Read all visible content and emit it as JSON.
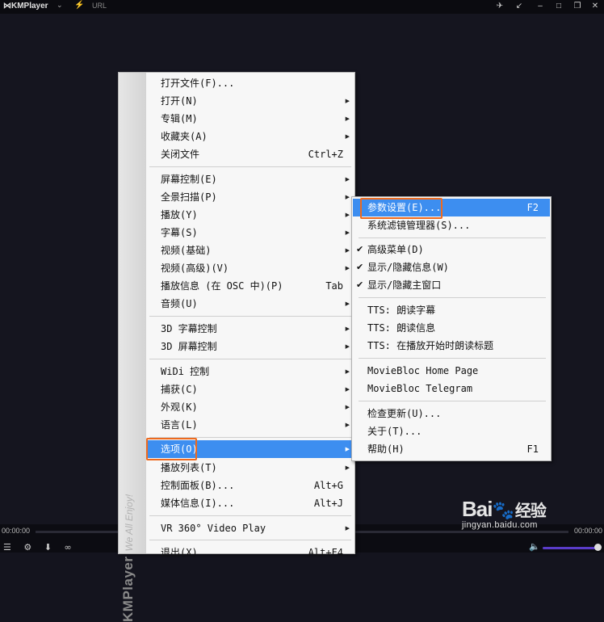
{
  "titlebar": {
    "app_name": "KMPlayer",
    "url_label": "URL",
    "logo_icon": "kmplayer-logo-icon",
    "controls": [
      "pin-icon",
      "minimize-to-corner-icon",
      "minimize-icon",
      "maximize-icon",
      "close-icon"
    ]
  },
  "bottom": {
    "time_left": "00:00:00",
    "time_right": "00:00:00"
  },
  "strip": {
    "brand": "KMPlayer",
    "tagline": "We All Enjoy!"
  },
  "main_menu": {
    "items": [
      {
        "label": "打开文件(F)...",
        "shortcut": "",
        "arrow": ""
      },
      {
        "label": "打开(N)",
        "shortcut": "",
        "arrow": "▶"
      },
      {
        "label": "专辑(M)",
        "shortcut": "",
        "arrow": "▶"
      },
      {
        "label": "收藏夹(A)",
        "shortcut": "",
        "arrow": "▶"
      },
      {
        "label": "关闭文件",
        "shortcut": "Ctrl+Z",
        "arrow": ""
      },
      {
        "label": "屏幕控制(E)",
        "shortcut": "",
        "arrow": "▶"
      },
      {
        "label": "全景扫描(P)",
        "shortcut": "",
        "arrow": "▶"
      },
      {
        "label": "播放(Y)",
        "shortcut": "",
        "arrow": "▶"
      },
      {
        "label": "字幕(S)",
        "shortcut": "",
        "arrow": "▶"
      },
      {
        "label": "视频(基础)",
        "shortcut": "",
        "arrow": "▶"
      },
      {
        "label": "视频(高级)(V)",
        "shortcut": "",
        "arrow": "▶"
      },
      {
        "label": "播放信息 (在 OSC 中)(P)",
        "shortcut": "Tab",
        "arrow": ""
      },
      {
        "label": "音频(U)",
        "shortcut": "",
        "arrow": "▶"
      },
      {
        "label": "3D 字幕控制",
        "shortcut": "",
        "arrow": "▶"
      },
      {
        "label": "3D 屏幕控制",
        "shortcut": "",
        "arrow": "▶"
      },
      {
        "label": "WiDi 控制",
        "shortcut": "",
        "arrow": "▶"
      },
      {
        "label": "捕获(C)",
        "shortcut": "",
        "arrow": "▶"
      },
      {
        "label": "外观(K)",
        "shortcut": "",
        "arrow": "▶"
      },
      {
        "label": "语言(L)",
        "shortcut": "",
        "arrow": "▶"
      },
      {
        "label": "选项(O)",
        "shortcut": "",
        "arrow": "▶"
      },
      {
        "label": "播放列表(T)",
        "shortcut": "",
        "arrow": "▶"
      },
      {
        "label": "控制面板(B)...",
        "shortcut": "Alt+G",
        "arrow": ""
      },
      {
        "label": "媒体信息(I)...",
        "shortcut": "Alt+J",
        "arrow": ""
      },
      {
        "label": "VR 360° Video Play",
        "shortcut": "",
        "arrow": "▶"
      },
      {
        "label": "退出(X)",
        "shortcut": "Alt+F4",
        "arrow": ""
      }
    ]
  },
  "sub_menu": {
    "items": [
      {
        "label": "参数设置(E)...",
        "shortcut": "F2",
        "check": ""
      },
      {
        "label": "系统滤镜管理器(S)...",
        "shortcut": "",
        "check": ""
      },
      {
        "label": "高级菜单(D)",
        "shortcut": "",
        "check": "✔"
      },
      {
        "label": "显示/隐藏信息(W)",
        "shortcut": "",
        "check": "✔"
      },
      {
        "label": "显示/隐藏主窗口",
        "shortcut": "",
        "check": "✔"
      },
      {
        "label": "TTS: 朗读字幕",
        "shortcut": "",
        "check": ""
      },
      {
        "label": "TTS: 朗读信息",
        "shortcut": "",
        "check": ""
      },
      {
        "label": "TTS: 在播放开始时朗读标题",
        "shortcut": "",
        "check": ""
      },
      {
        "label": "MovieBloc Home Page",
        "shortcut": "",
        "check": ""
      },
      {
        "label": "MovieBloc Telegram",
        "shortcut": "",
        "check": ""
      },
      {
        "label": "检查更新(U)...",
        "shortcut": "",
        "check": ""
      },
      {
        "label": "关于(T)...",
        "shortcut": "",
        "check": ""
      },
      {
        "label": "帮助(H)",
        "shortcut": "F1",
        "check": ""
      }
    ]
  },
  "watermark": {
    "logo": "Bai",
    "logo_cn": "经验",
    "url": "jingyan.baidu.com"
  },
  "colors": {
    "highlight": "#3d8ef0",
    "annotation_box": "#ee6a1e",
    "background": "#14141e"
  }
}
